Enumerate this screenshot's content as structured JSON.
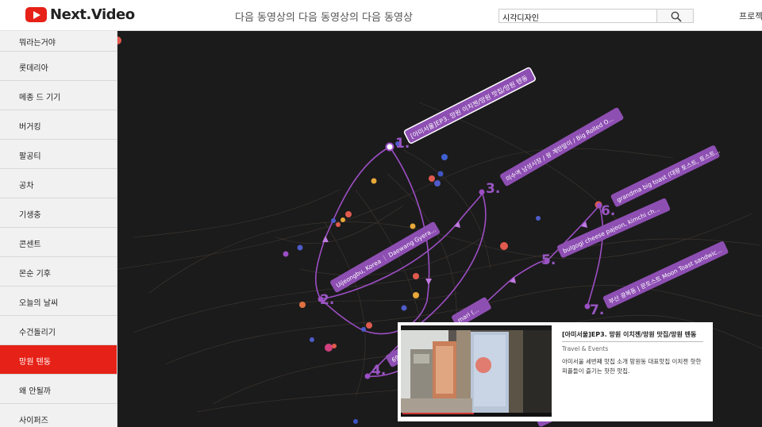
{
  "header": {
    "brand": "Next.Video",
    "page_title": "다음 동영상의 다음 동영상의 다음 동영상",
    "search_value": "시각디자인",
    "nav_project": "프로젝"
  },
  "sidebar": {
    "items": [
      {
        "label": "뭐라는거야",
        "active": false
      },
      {
        "label": "롯데리아",
        "active": false
      },
      {
        "label": "메종 드 기기",
        "active": false
      },
      {
        "label": "버거킹",
        "active": false
      },
      {
        "label": "팔공티",
        "active": false
      },
      {
        "label": "공차",
        "active": false
      },
      {
        "label": "기생충",
        "active": false
      },
      {
        "label": "콘센트",
        "active": false
      },
      {
        "label": "몬순 기후",
        "active": false
      },
      {
        "label": "오늘의 날씨",
        "active": false
      },
      {
        "label": "수건돌리기",
        "active": false
      },
      {
        "label": "망원 텐동",
        "active": true
      },
      {
        "label": "왜 안될까",
        "active": false
      },
      {
        "label": "사이퍼즈",
        "active": false
      }
    ]
  },
  "graph": {
    "colors": {
      "path": "#9c4ec4",
      "label_bg": "#8e4fb3",
      "label_text": "#ffffff",
      "number": "#9a56c4"
    },
    "nodes": [
      {
        "number": "1.",
        "label": "[아미서울]EP3. 망원 이치젠/망원 맛집/망원 텐동"
      },
      {
        "number": "2.",
        "label": "Uijeongbu, Korea ｜ Daewang Gyera..."
      },
      {
        "number": "3.",
        "label": "미수역 남성시장 / 왕 계란말이 / Big Rolled O..."
      },
      {
        "number": "4.",
        "label": "69..."
      },
      {
        "number": "5.",
        "label": "bulgogi cheese pajeon, kimchi ch..."
      },
      {
        "number": "6.",
        "label": "grandma big toast (대왕 토스트, 토스트..."
      },
      {
        "number": "7.",
        "label": "부산 광복동 | 문토스트 Moon Toast sandwic..."
      }
    ],
    "hidden_label": "mari (..."
  },
  "preview": {
    "title": "[아미서울]EP3. 망원 이치젠/망원 맛집/망원 텐동",
    "category": "Travel & Events",
    "description": "아미서울 세번째 맛집 소개 망원동 대표맛집 이치젠 핫한 피플들이 즐기는 핫한 맛집."
  }
}
